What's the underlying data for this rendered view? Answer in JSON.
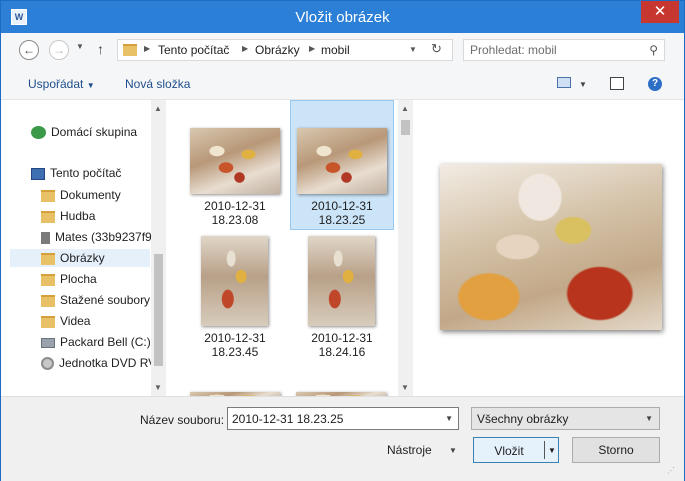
{
  "window": {
    "title": "Vložit obrázek",
    "app_icon": "W",
    "close_glyph": "✕"
  },
  "navigation": {
    "back_glyph": "←",
    "forward_glyph": "→",
    "up_glyph": "↑",
    "dropdown_glyph": "▼",
    "chevron_glyph": "▶",
    "refresh_glyph": "↻",
    "breadcrumb": [
      "Tento počítač",
      "Obrázky",
      "mobil"
    ],
    "search": {
      "placeholder": "Prohledat: mobil",
      "icon": "search-icon",
      "glyph": "⚲"
    }
  },
  "toolbar": {
    "organize_label": "Uspořádat",
    "organize_arrow": "▼",
    "new_folder_label": "Nová složka",
    "view_arrow": "▼",
    "help_glyph": "?"
  },
  "nav_pane": {
    "items": [
      {
        "label": "Domácí skupina",
        "icon": "homegroup-icon"
      },
      {
        "label": "Tento počítač",
        "icon": "computer-icon"
      },
      {
        "label": "Dokumenty",
        "icon": "folder-icon"
      },
      {
        "label": "Hudba",
        "icon": "folder-icon"
      },
      {
        "label": "Mates (33b9237f9",
        "icon": "phone-icon"
      },
      {
        "label": "Obrázky",
        "icon": "folder-icon",
        "selected": true
      },
      {
        "label": "Plocha",
        "icon": "folder-icon"
      },
      {
        "label": "Stažené soubory",
        "icon": "folder-icon"
      },
      {
        "label": "Videa",
        "icon": "folder-icon"
      },
      {
        "label": "Packard Bell (C:)",
        "icon": "drive-icon"
      },
      {
        "label": "Jednotka DVD RV",
        "icon": "dvd-icon"
      }
    ],
    "scroll_up": "▲",
    "scroll_down": "▼"
  },
  "files": [
    {
      "date": "2010-12-31",
      "time": "18.23.08",
      "selected": false,
      "orientation": "landscape"
    },
    {
      "date": "2010-12-31",
      "time": "18.23.25",
      "selected": true,
      "orientation": "landscape"
    },
    {
      "date": "2010-12-31",
      "time": "18.23.45",
      "selected": false,
      "orientation": "portrait"
    },
    {
      "date": "2010-12-31",
      "time": "18.24.16",
      "selected": false,
      "orientation": "portrait"
    }
  ],
  "bottom": {
    "filename_label": "Název souboru:",
    "filename_value": "2010-12-31 18.23.25",
    "filetype_value": "Všechny obrázky",
    "tools_label": "Nástroje",
    "insert_label": "Vložit",
    "cancel_label": "Storno",
    "arrow_glyph": "▼"
  }
}
